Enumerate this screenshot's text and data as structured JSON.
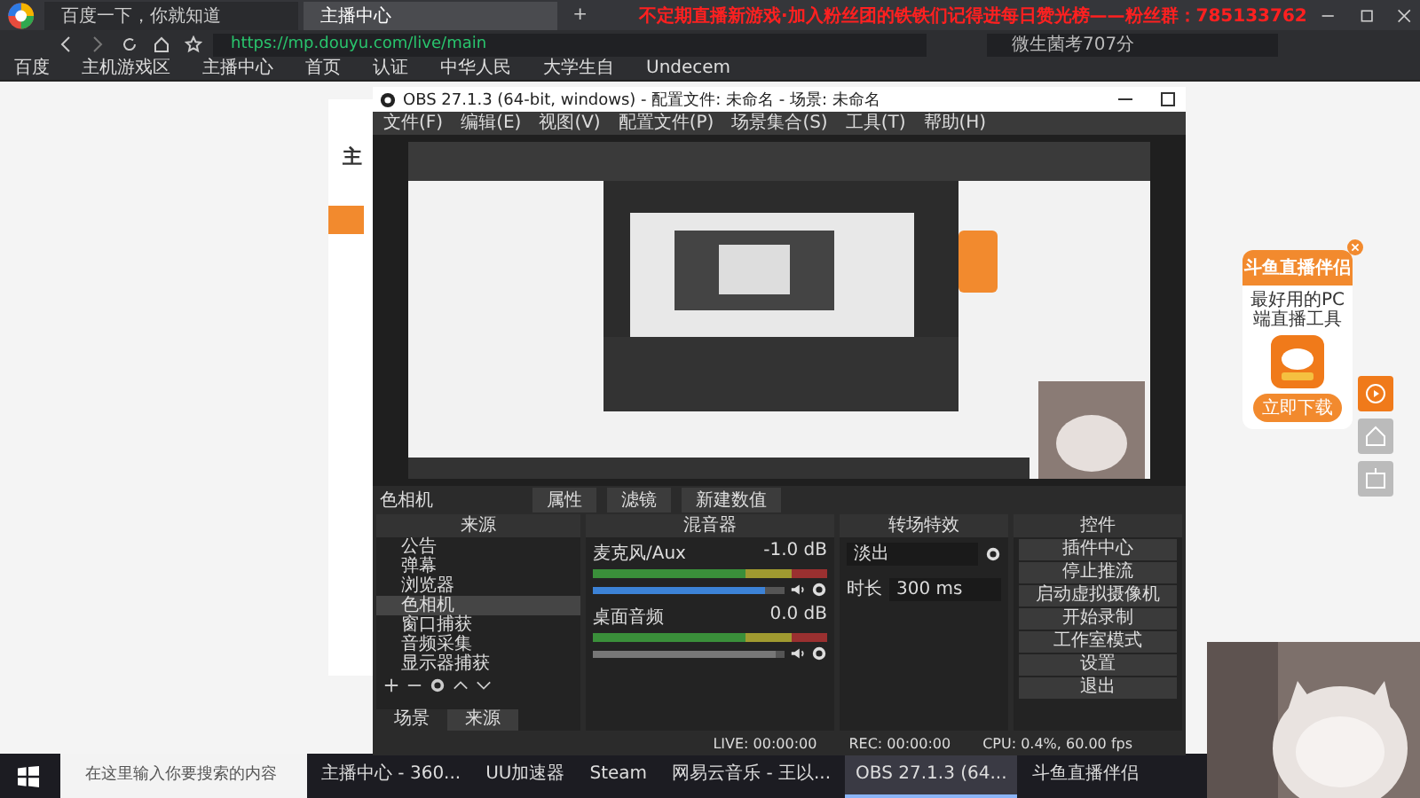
{
  "browser": {
    "tabs": [
      {
        "label": "百度一下，你就知道",
        "selected": false
      },
      {
        "label": "主播中心",
        "selected": true
      }
    ],
    "new_tab": "+",
    "banner": "不定期直播新游戏·加入粉丝团的铁铁们记得进每日赞光榜——粉丝群：785133762",
    "url": "https://mp.douyu.com/live/main",
    "search": {
      "value": "微生菌考707分"
    },
    "bookmarks": [
      "百度",
      "主机游戏区",
      "主播中心",
      "首页",
      "认证",
      "中华人民",
      "大学生自",
      "Undecem"
    ]
  },
  "page": {
    "heading": "主"
  },
  "obs": {
    "title": "OBS 27.1.3 (64-bit, windows) - 配置文件: 未命名 - 场景: 未命名",
    "menu": [
      "文件(F)",
      "编辑(E)",
      "视图(V)",
      "配置文件(P)",
      "场景集合(S)",
      "工具(T)",
      "帮助(H)"
    ],
    "source_bar": {
      "name": "色相机",
      "buttons": [
        "属性",
        "滤镜",
        "新建数值"
      ]
    },
    "sources": {
      "title": "来源",
      "items": [
        {
          "label": "公告",
          "selected": false
        },
        {
          "label": "弹幕",
          "selected": false
        },
        {
          "label": "浏览器",
          "selected": false
        },
        {
          "label": "色相机",
          "selected": true
        },
        {
          "label": "窗口捕获",
          "selected": false
        },
        {
          "label": "音频采集",
          "selected": false
        },
        {
          "label": "显示器捕获",
          "selected": false
        }
      ]
    },
    "dock_tabs": [
      {
        "label": "场景",
        "selected": false
      },
      {
        "label": "来源",
        "selected": true
      }
    ],
    "mixer": {
      "title": "混音器",
      "channels": [
        {
          "name": "麦克风/Aux",
          "reading": "-1.0 dB",
          "level": 0.9,
          "disabled": false
        },
        {
          "name": "桌面音频",
          "reading": "0.0 dB",
          "level": 0.95,
          "disabled": true
        }
      ]
    },
    "transitions": {
      "title": "转场特效",
      "type": "淡出",
      "duration_label": "时长",
      "duration": "300 ms"
    },
    "controls": {
      "title": "控件",
      "buttons": [
        "插件中心",
        "停止推流",
        "启动虚拟摄像机",
        "开始录制",
        "工作室模式",
        "设置",
        "退出"
      ]
    },
    "status": [
      "LIVE: 00:00:00",
      "REC: 00:00:00",
      "CPU: 0.4%, 60.00 fps"
    ]
  },
  "ad": {
    "title": "斗鱼直播伴侣",
    "subtitle": "最好用的PC端直播工具",
    "button": "立即下载"
  },
  "taskbar": {
    "search_placeholder": "在这里输入你要搜索的内容",
    "apps": [
      {
        "label": "主播中心 - 360...",
        "selected": false
      },
      {
        "label": "UU加速器",
        "selected": false
      },
      {
        "label": "Steam",
        "selected": false
      },
      {
        "label": "网易云音乐 - 王以...",
        "selected": false
      },
      {
        "label": "OBS 27.1.3 (64...",
        "selected": true
      },
      {
        "label": "斗鱼直播伴侣",
        "selected": false
      }
    ]
  }
}
